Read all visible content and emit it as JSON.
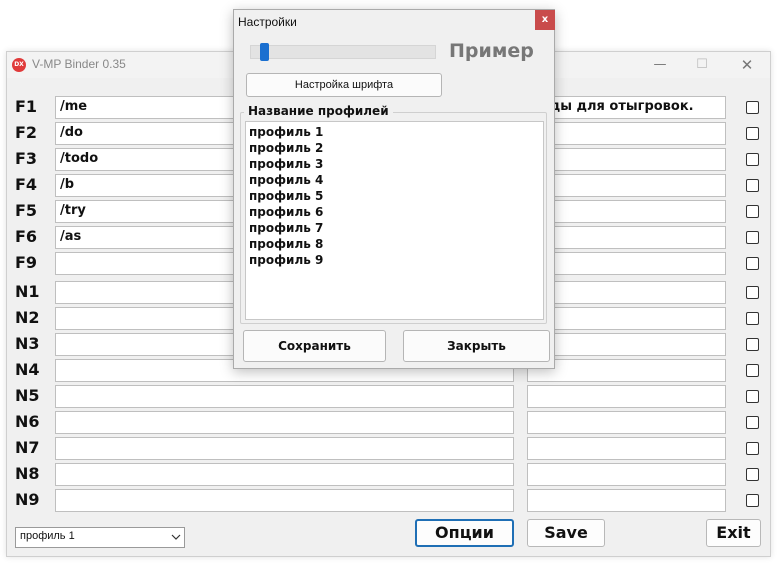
{
  "main_window": {
    "logo_text": "DX",
    "title": "V-MP Binder 0.35",
    "minimize_glyph": "—",
    "maximize_glyph": "☐",
    "close_glyph": "✕",
    "rows": [
      {
        "label": "F1",
        "command": "/me",
        "text": "анды для отыгровок.",
        "checked": false
      },
      {
        "label": "F2",
        "command": "/do",
        "text": "",
        "checked": false
      },
      {
        "label": "F3",
        "command": "/todo",
        "text": "",
        "checked": false
      },
      {
        "label": "F4",
        "command": "/b",
        "text": "",
        "checked": false
      },
      {
        "label": "F5",
        "command": "/try",
        "text": "",
        "checked": false
      },
      {
        "label": "F6",
        "command": "/as",
        "text": "",
        "checked": false
      },
      {
        "label": "F9",
        "command": "",
        "text": "",
        "checked": false
      },
      {
        "label": "N1",
        "command": "",
        "text": "",
        "checked": false
      },
      {
        "label": "N2",
        "command": "",
        "text": "",
        "checked": false
      },
      {
        "label": "N3",
        "command": "",
        "text": "",
        "checked": false
      },
      {
        "label": "N4",
        "command": "",
        "text": "",
        "checked": false
      },
      {
        "label": "N5",
        "command": "",
        "text": "",
        "checked": false
      },
      {
        "label": "N6",
        "command": "",
        "text": "",
        "checked": false
      },
      {
        "label": "N7",
        "command": "",
        "text": "",
        "checked": false
      },
      {
        "label": "N8",
        "command": "",
        "text": "",
        "checked": false
      },
      {
        "label": "N9",
        "command": "",
        "text": "",
        "checked": false
      }
    ],
    "profile_select": {
      "value": "профиль 1"
    },
    "buttons": {
      "options": "Опции",
      "save": "Save",
      "exit": "Exit"
    }
  },
  "settings_dialog": {
    "title": "Настройки",
    "close_glyph": "x",
    "font_size_slider": {
      "level": 0.05
    },
    "preview_text": "Пример",
    "font_button": "Настройка шрифта",
    "group_caption": "Название профилей",
    "profiles": [
      "профиль 1",
      "профиль 2",
      "профиль 3",
      "профиль 4",
      "профиль 5",
      "профиль 6",
      "профиль 7",
      "профиль 8",
      "профиль 9"
    ],
    "save_button": "Сохранить",
    "close_button": "Закрыть"
  },
  "colors": {
    "accent": "#1f6fb5",
    "slider_thumb": "#1a6fd0",
    "dialog_close": "#c94b4b",
    "logo": "#e03a3a"
  }
}
